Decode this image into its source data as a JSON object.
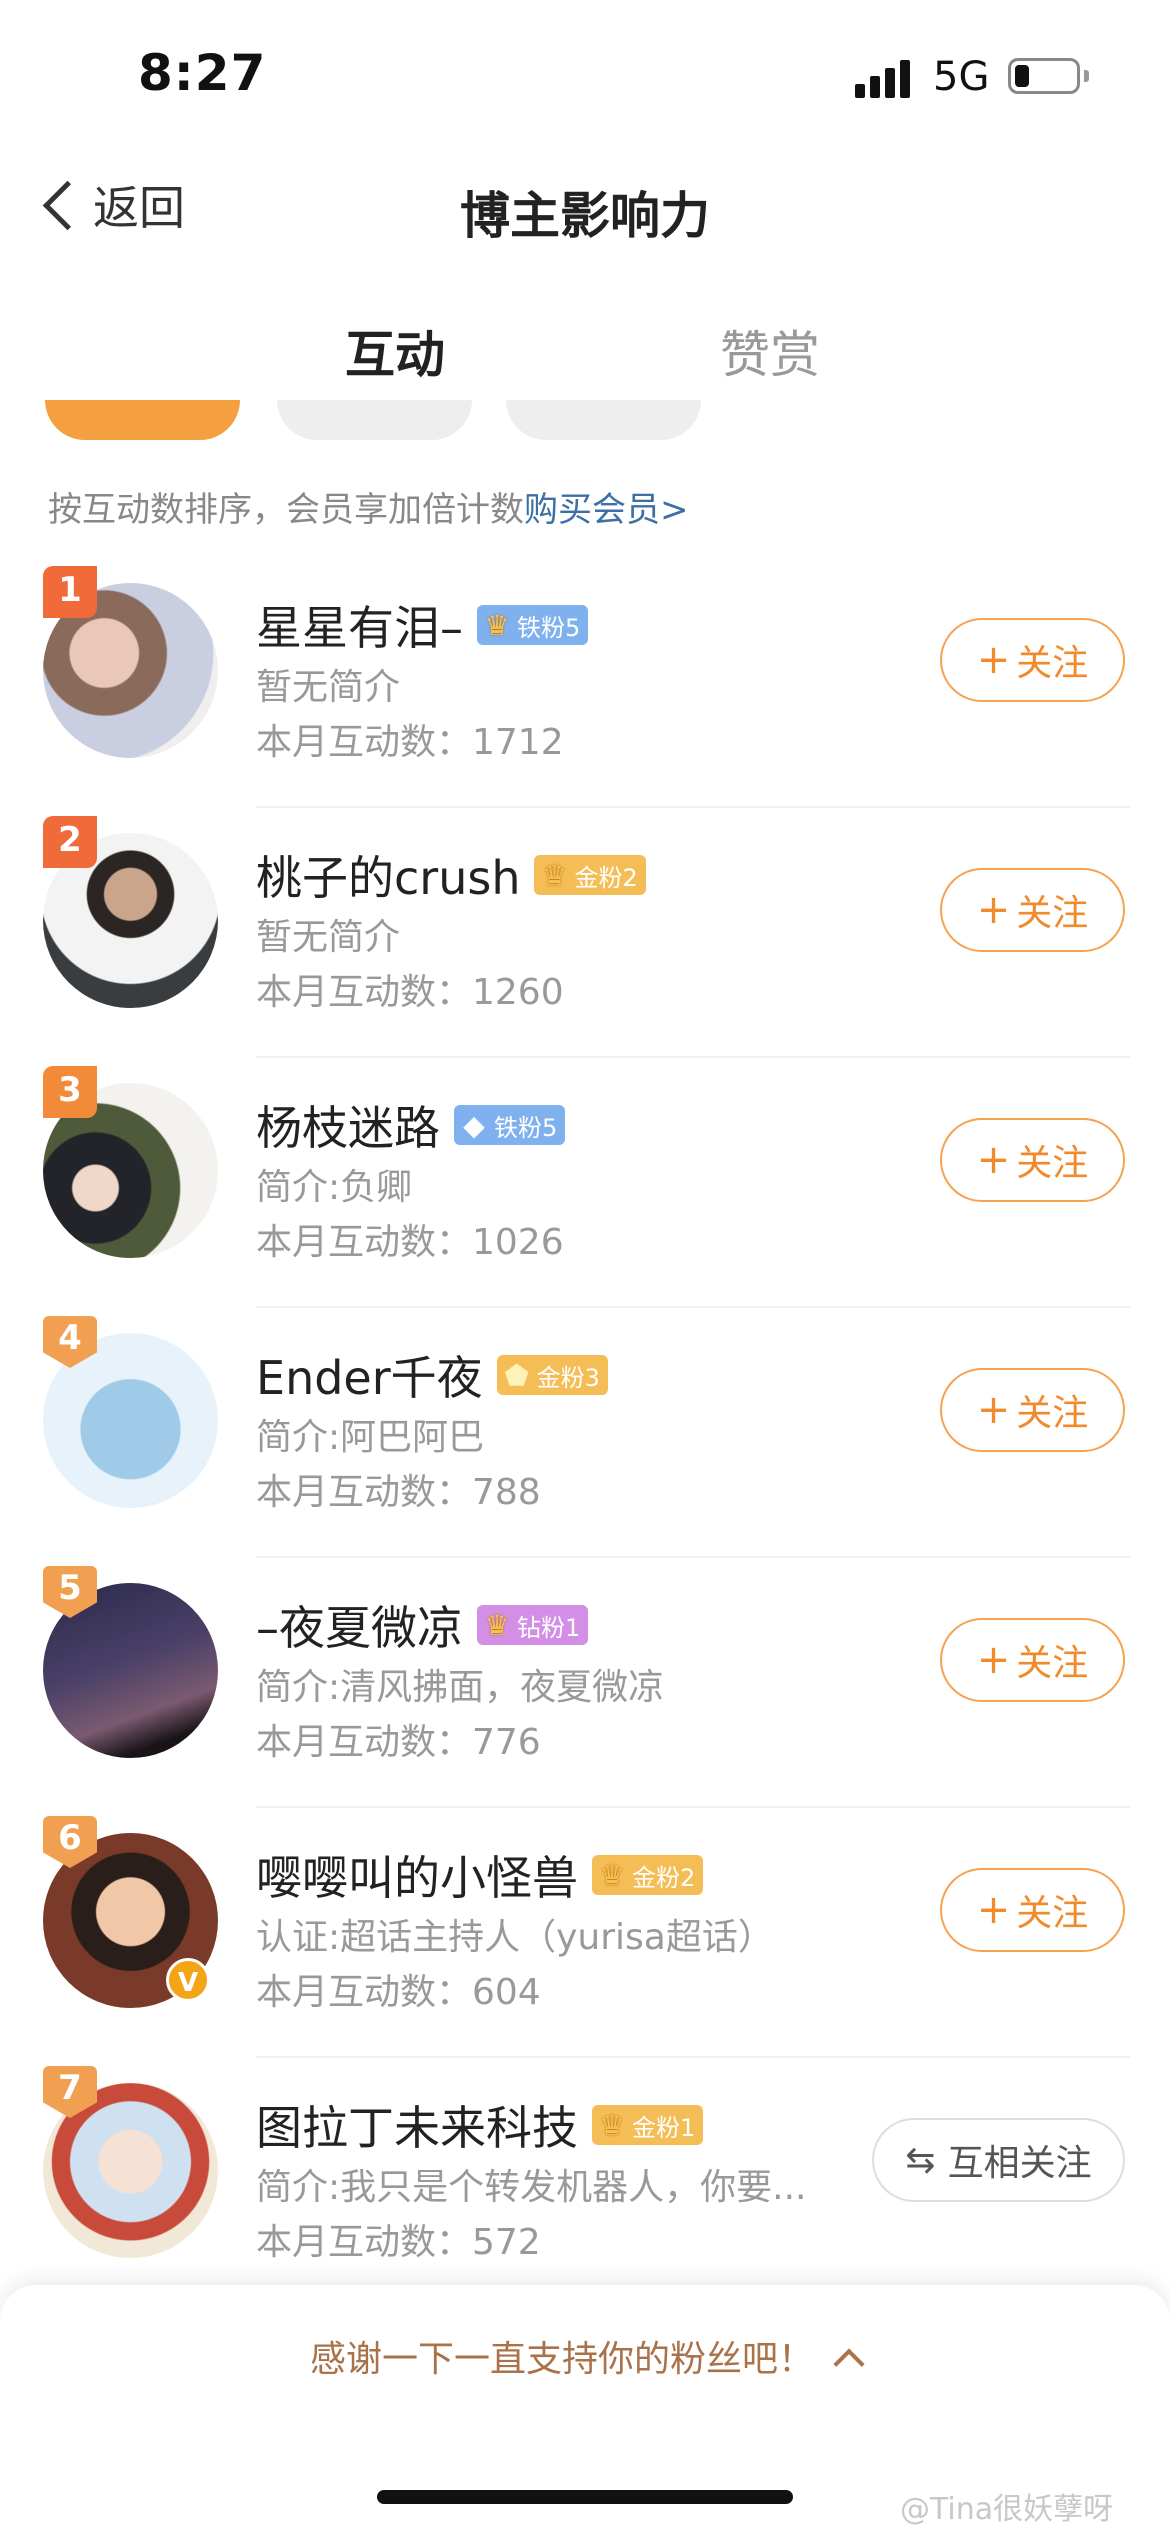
{
  "status_bar": {
    "time": "8:27",
    "network": "5G"
  },
  "nav": {
    "back_label": "返回",
    "title": "博主影响力"
  },
  "tabs": [
    {
      "label": "互动"
    },
    {
      "label": "赞赏"
    }
  ],
  "sort_hint": {
    "text": "按互动数排序，会员享加倍计数",
    "link": "购买会员>"
  },
  "fans": [
    {
      "rank": "1",
      "name": "星星有泪–",
      "badge": "铁粉5",
      "intro": "暂无简介",
      "count": "本月互动数：1712",
      "action": "关注"
    },
    {
      "rank": "2",
      "name": "桃子的crush",
      "badge": "金粉2",
      "intro": "暂无简介",
      "count": "本月互动数：1260",
      "action": "关注"
    },
    {
      "rank": "3",
      "name": "杨枝迷路",
      "badge": "铁粉5",
      "intro": "简介:负卿",
      "count": "本月互动数：1026",
      "action": "关注"
    },
    {
      "rank": "4",
      "name": "Ender千夜",
      "badge": "金粉3",
      "intro": "简介:阿巴阿巴",
      "count": "本月互动数：788",
      "action": "关注"
    },
    {
      "rank": "5",
      "name": "–夜夏微凉",
      "badge": "钻粉1",
      "intro": "简介:清风拂面，夜夏微凉",
      "count": "本月互动数：776",
      "action": "关注"
    },
    {
      "rank": "6",
      "name": "嘤嘤叫的小怪兽",
      "badge": "金粉2",
      "intro": "认证:超话主持人（yurisa超话）",
      "count": "本月互动数：604",
      "action": "关注"
    },
    {
      "rank": "7",
      "name": "图拉丁未来科技",
      "badge": "金粉1",
      "intro": "简介:我只是个转发机器人，你要...",
      "count": "本月互动数：572",
      "action": "互相关注"
    }
  ],
  "footer": {
    "text": "感谢一下一直支持你的粉丝吧！"
  },
  "watermark": "@Tina很妖孽呀",
  "colors": {
    "accent": "#f28a1e",
    "link": "#3d6fa6",
    "iron_fan": "#7fb1ef",
    "gold_fan": "#f4bd55",
    "diamond_fan": "#d38fe5"
  }
}
